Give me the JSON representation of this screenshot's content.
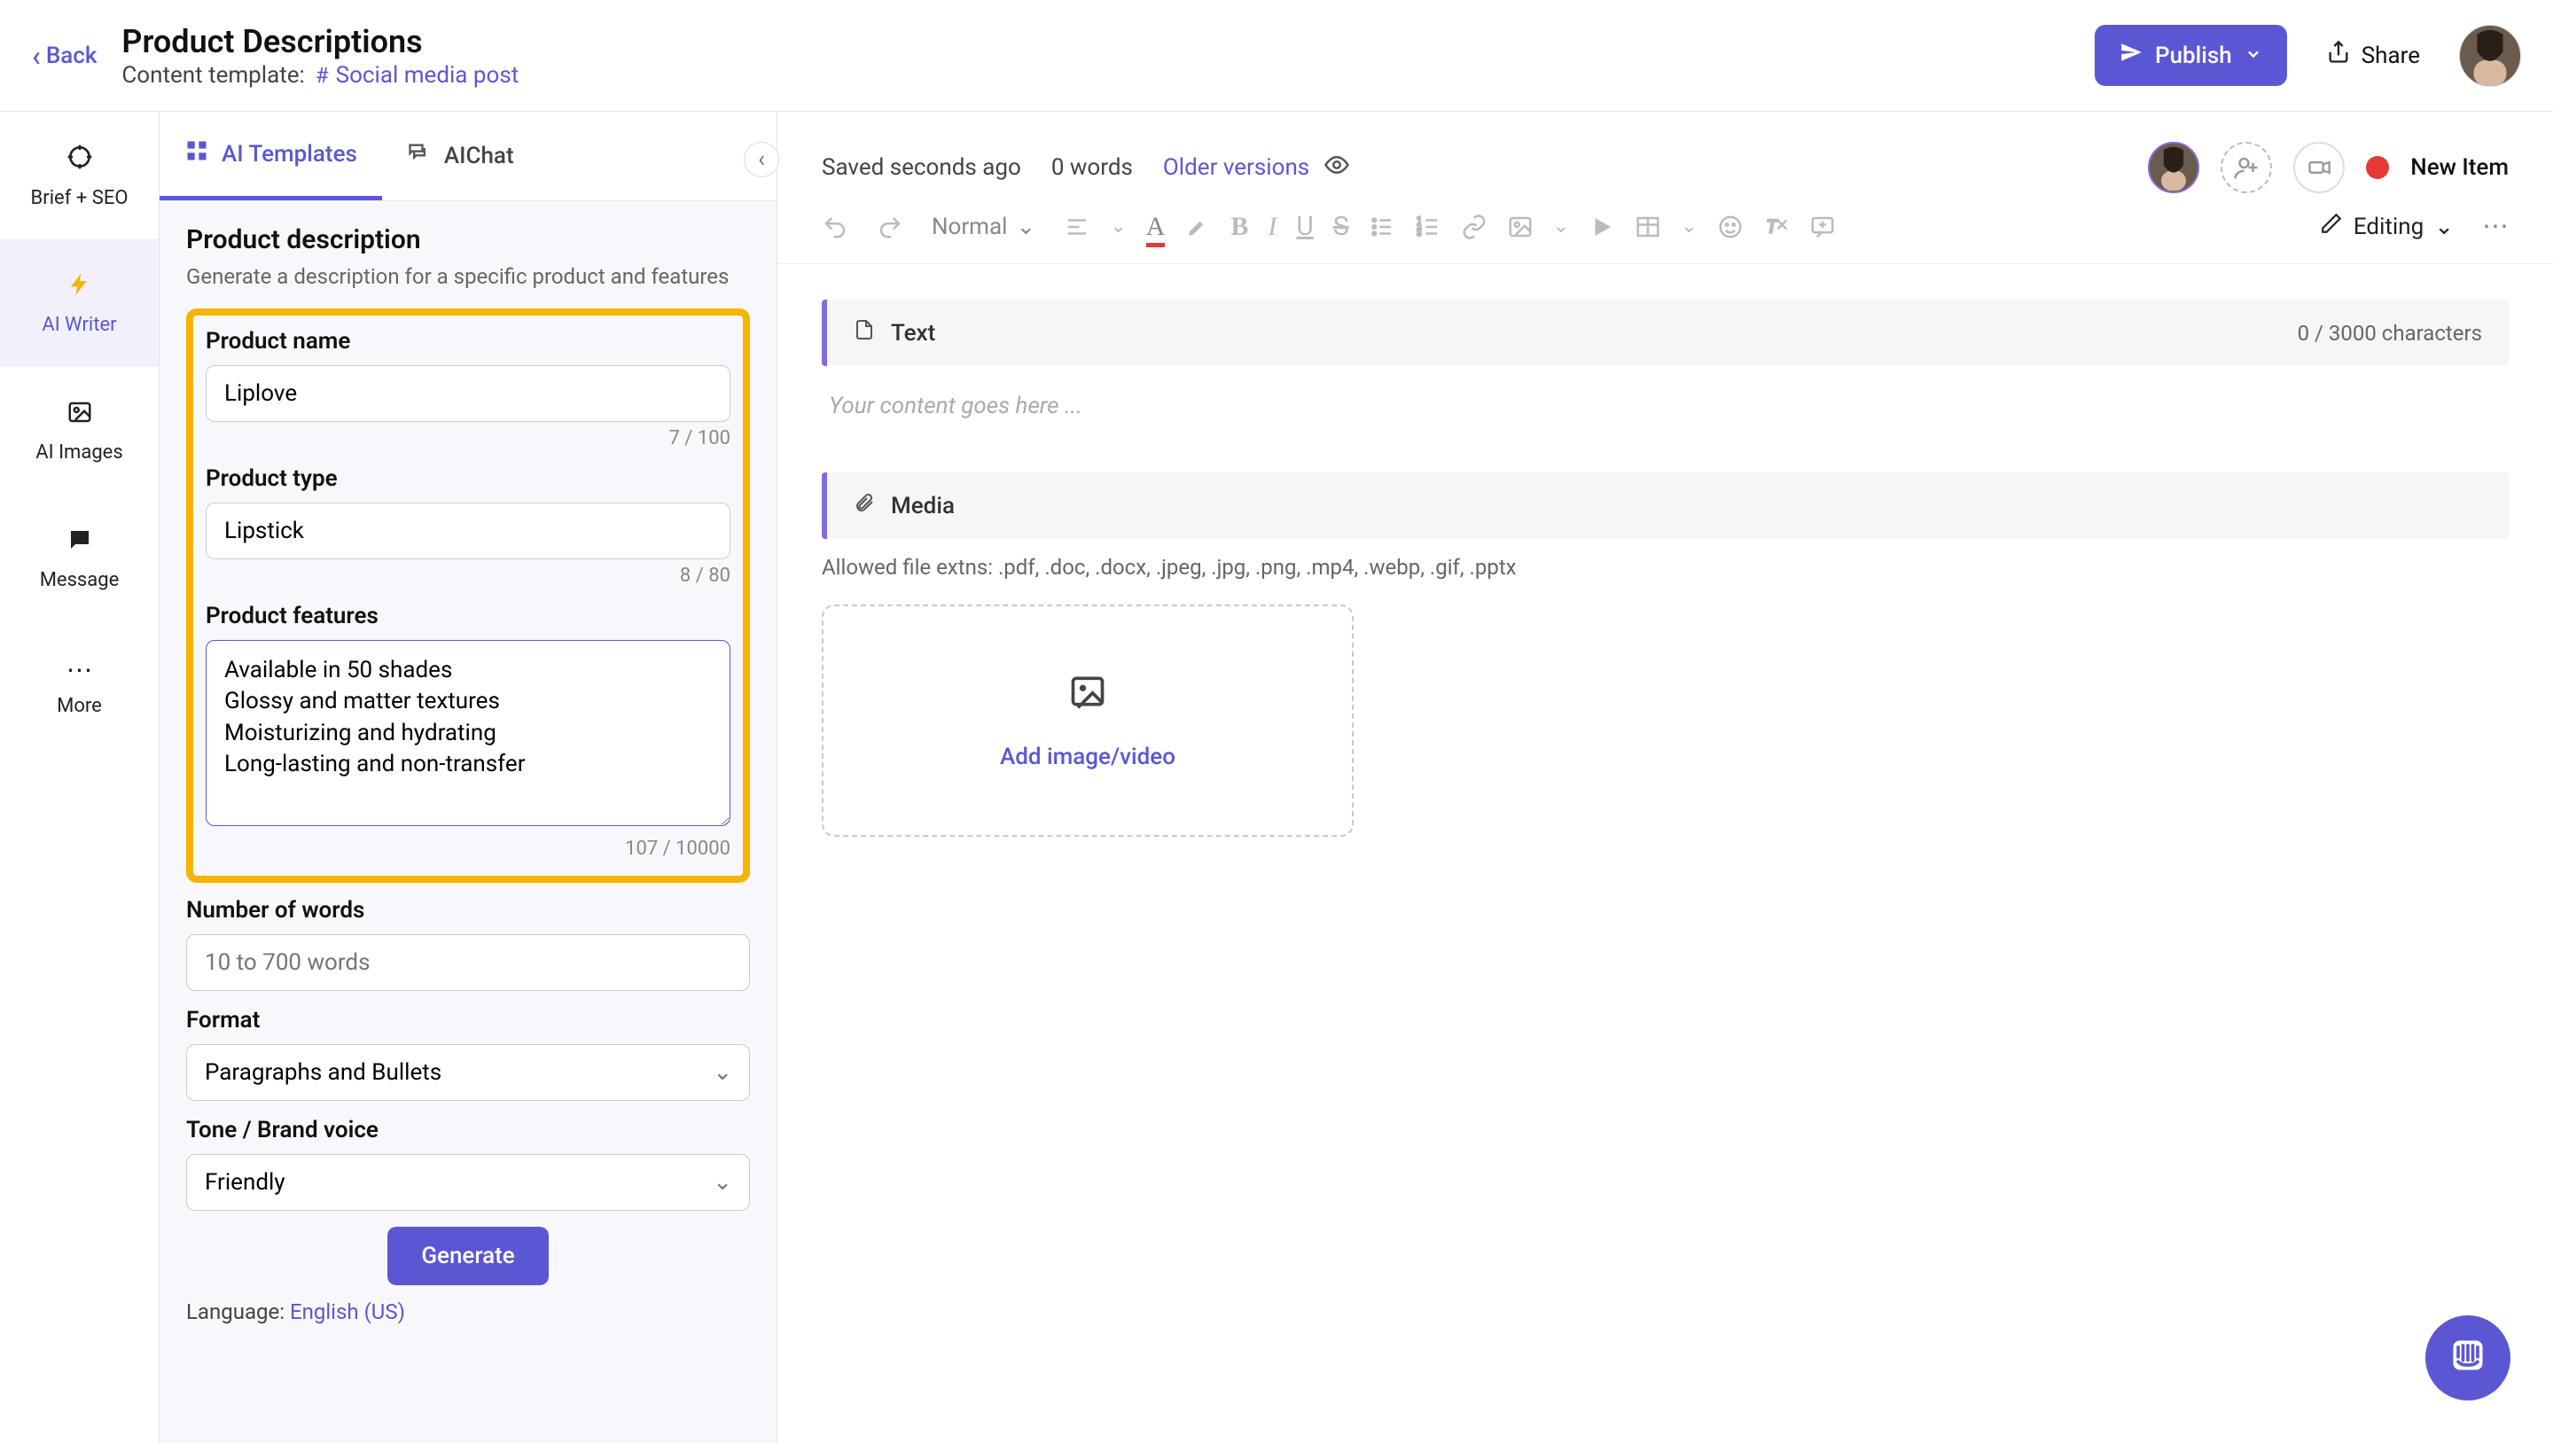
{
  "header": {
    "back": "Back",
    "title": "Product Descriptions",
    "template_prefix": "Content template:",
    "template_name": "Social media post",
    "publish": "Publish",
    "share": "Share"
  },
  "rail": {
    "brief": "Brief + SEO",
    "writer": "AI Writer",
    "images": "AI Images",
    "message": "Message",
    "more": "More"
  },
  "ai": {
    "tab_templates": "AI Templates",
    "tab_chat": "AIChat",
    "heading": "Product description",
    "subtitle": "Generate a description for a specific product and features",
    "product_name_label": "Product name",
    "product_name_value": "Liplove",
    "product_name_counter": "7 / 100",
    "product_type_label": "Product type",
    "product_type_value": "Lipstick",
    "product_type_counter": "8 / 80",
    "features_label": "Product features",
    "features_value": "Available in 50 shades\nGlossy and matter textures\nMoisturizing and hydrating\nLong-lasting and non-transfer",
    "features_counter": "107 / 10000",
    "words_label": "Number of words",
    "words_placeholder": "10 to 700 words",
    "format_label": "Format",
    "format_value": "Paragraphs and Bullets",
    "tone_label": "Tone / Brand voice",
    "tone_value": "Friendly",
    "generate": "Generate",
    "language_prefix": "Language:",
    "language_value": "English (US)"
  },
  "content": {
    "saved": "Saved seconds ago",
    "words": "0 words",
    "older_versions": "Older versions",
    "status_label": "New Item",
    "toolbar_normal": "Normal",
    "toolbar_editing": "Editing",
    "text_block": "Text",
    "char_counter": "0 / 3000 characters",
    "placeholder": "Your content goes here ...",
    "media_block": "Media",
    "allowed": "Allowed file extns: .pdf, .doc, .docx, .jpeg, .jpg, .png, .mp4, .webp, .gif, .pptx",
    "dropzone": "Add image/video"
  }
}
